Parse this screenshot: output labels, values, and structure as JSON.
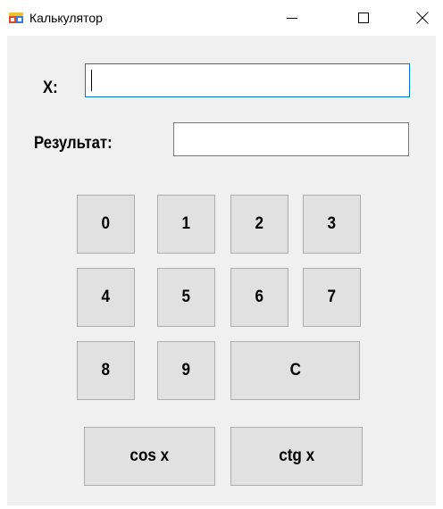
{
  "window": {
    "title": "Калькулятор",
    "icon": "windows-forms-app-icon",
    "controls": {
      "minimize_icon": "minimize-icon",
      "maximize_icon": "maximize-icon",
      "close_icon": "close-icon"
    }
  },
  "form": {
    "x_label": "X:",
    "x_value": "",
    "result_label": "Результат:",
    "result_value": ""
  },
  "keypad": {
    "digits": [
      "0",
      "1",
      "2",
      "3",
      "4",
      "5",
      "6",
      "7",
      "8",
      "9"
    ],
    "clear_label": "C",
    "cos_label": "cos x",
    "ctg_label": "ctg x"
  },
  "colors": {
    "client_background": "#f0f0f0",
    "button_face": "#e1e1e1",
    "button_border": "#adadad",
    "focus_border": "#0078d7",
    "input_border": "#7a7a7a"
  }
}
